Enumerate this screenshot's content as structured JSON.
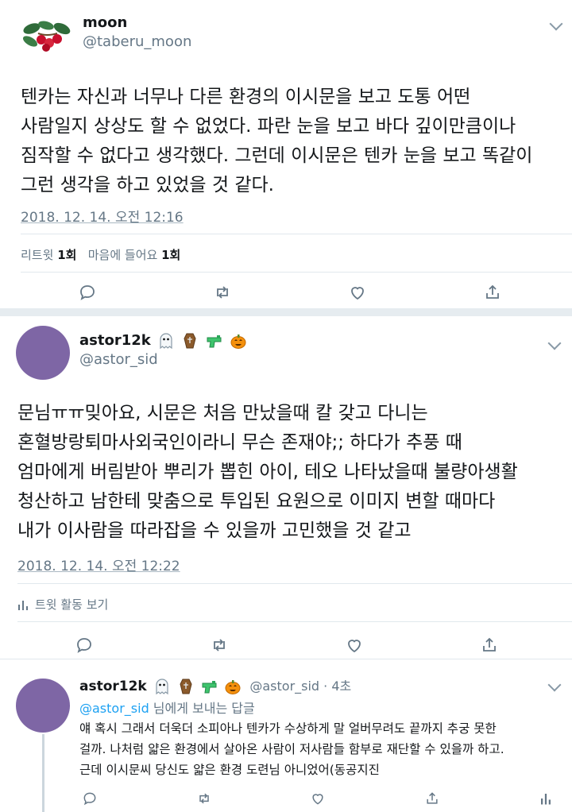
{
  "tweet1": {
    "name": "moon",
    "handle": "@taberu_moon",
    "lines": [
      "텐카는 자신과 너무나 다른 환경의 이시문을 보고 도통 어떤",
      "사람일지 상상도 할 수 없었다. 파란 눈을 보고 바다 깊이만큼이나",
      "짐작할 수 없다고 생각했다. 그런데 이시문은 텐카 눈을 보고 똑같이",
      "그런 생각을 하고 있었을 것 같다."
    ],
    "timestamp": "2018. 12. 14. 오전 12:16",
    "stats": {
      "retweet_label": "리트윗",
      "retweet_count": "1회",
      "like_label": "마음에 들어요",
      "like_count": "1회"
    }
  },
  "tweet2": {
    "name": "astor12k",
    "handle": "@astor_sid",
    "name_emojis": [
      "ghost-icon",
      "coffin-icon",
      "water-pistol-icon",
      "jack-o-lantern-icon"
    ],
    "lines": [
      "문님ㅠㅠ밎아요, 시문은 처음 만났을때 칼 갖고 다니는",
      "혼혈방랑퇴마사외국인이라니 무슨 존재야;; 하다가 추풍 때",
      "엄마에게 버림받아 뿌리가 뽑힌 아이, 테오 나타났을때 불량아생활",
      "청산하고 남한테 맞춤으로 투입된 요원으로 이미지 변할 때마다",
      "내가 이사람을 따라잡을 수 있을까 고민했을 것 같고"
    ],
    "timestamp": "2018. 12. 14. 오전 12:22",
    "activity_label": "트윗 활동 보기"
  },
  "tweet3": {
    "name": "astor12k",
    "handle_time": "@astor_sid · 4초",
    "reply_handle": "@astor_sid",
    "reply_suffix": " 님에게 보내는 답글",
    "lines": [
      "얘 혹시 그래서 더욱더 소피아나 텐카가 수상하게 말 얼버무려도 끝까지 추궁 못한",
      "걸까. 나처럼 얇은 환경에서 살아온 사람이 저사람들 함부로 재단할 수 있을까 하고.",
      "근데 이시문씨 당신도 얇은 환경 도련님 아니었어(동공지진"
    ]
  },
  "colors": {
    "accent": "#1da1f2",
    "avatar": "#7e66a5",
    "muted": "#657786",
    "separator": "#e6ecf0"
  }
}
